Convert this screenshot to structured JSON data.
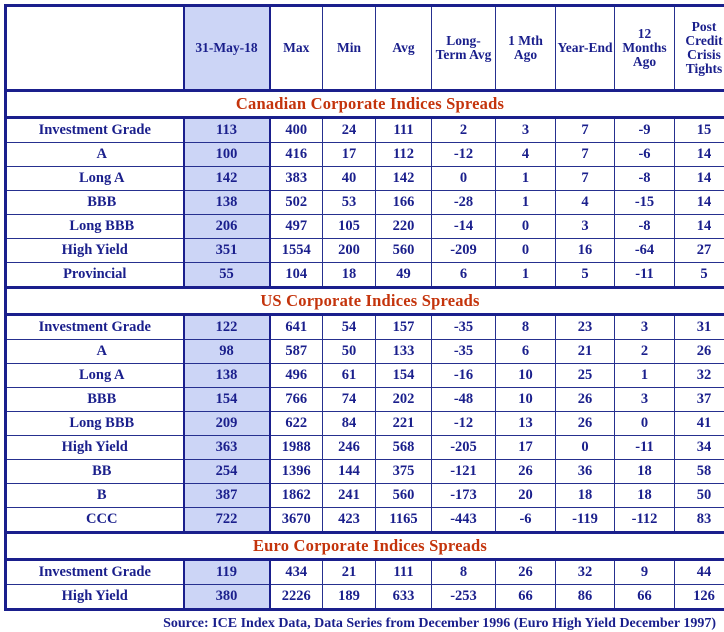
{
  "table": {
    "columns": [
      {
        "key": "label",
        "label": ""
      },
      {
        "key": "current",
        "label": "31-May-18",
        "highlighted": true
      },
      {
        "key": "max",
        "label": "Max"
      },
      {
        "key": "min",
        "label": "Min"
      },
      {
        "key": "avg",
        "label": "Avg"
      },
      {
        "key": "lta",
        "label": "Long-Term Avg"
      },
      {
        "key": "m1",
        "label": "1 Mth Ago"
      },
      {
        "key": "ye",
        "label": "Year-End"
      },
      {
        "key": "m12",
        "label": "12 Months Ago"
      },
      {
        "key": "pcct",
        "label": "Post Credit Crisis Tights"
      }
    ],
    "sections": [
      {
        "title": "Canadian Corporate Indices Spreads",
        "rows": [
          {
            "label": "Investment Grade",
            "indent": false,
            "values": [
              113,
              400,
              24,
              111,
              2,
              3,
              7,
              -9,
              15
            ]
          },
          {
            "label": "A",
            "indent": true,
            "values": [
              100,
              416,
              17,
              112,
              -12,
              4,
              7,
              -6,
              14
            ]
          },
          {
            "label": "Long A",
            "indent": true,
            "values": [
              142,
              383,
              40,
              142,
              0,
              1,
              7,
              -8,
              14
            ]
          },
          {
            "label": "BBB",
            "indent": true,
            "values": [
              138,
              502,
              53,
              166,
              -28,
              1,
              4,
              -15,
              14
            ]
          },
          {
            "label": "Long BBB",
            "indent": true,
            "values": [
              206,
              497,
              105,
              220,
              -14,
              0,
              3,
              -8,
              14
            ]
          },
          {
            "label": "High Yield",
            "indent": false,
            "values": [
              351,
              1554,
              200,
              560,
              -209,
              0,
              16,
              -64,
              27
            ]
          },
          {
            "label": "Provincial",
            "indent": false,
            "values": [
              55,
              104,
              18,
              49,
              6,
              1,
              5,
              -11,
              5
            ]
          }
        ]
      },
      {
        "title": "US Corporate Indices Spreads",
        "rows": [
          {
            "label": "Investment Grade",
            "indent": false,
            "values": [
              122,
              641,
              54,
              157,
              -35,
              8,
              23,
              3,
              31
            ]
          },
          {
            "label": "A",
            "indent": true,
            "values": [
              98,
              587,
              50,
              133,
              -35,
              6,
              21,
              2,
              26
            ]
          },
          {
            "label": "Long A",
            "indent": true,
            "values": [
              138,
              496,
              61,
              154,
              -16,
              10,
              25,
              1,
              32
            ]
          },
          {
            "label": "BBB",
            "indent": true,
            "values": [
              154,
              766,
              74,
              202,
              -48,
              10,
              26,
              3,
              37
            ]
          },
          {
            "label": "Long BBB",
            "indent": true,
            "values": [
              209,
              622,
              84,
              221,
              -12,
              13,
              26,
              0,
              41
            ]
          },
          {
            "label": "High Yield",
            "indent": false,
            "values": [
              363,
              1988,
              246,
              568,
              -205,
              17,
              0,
              -11,
              34
            ]
          },
          {
            "label": "BB",
            "indent": true,
            "values": [
              254,
              1396,
              144,
              375,
              -121,
              26,
              36,
              18,
              58
            ]
          },
          {
            "label": "B",
            "indent": true,
            "values": [
              387,
              1862,
              241,
              560,
              -173,
              20,
              18,
              18,
              50
            ]
          },
          {
            "label": "CCC",
            "indent": true,
            "values": [
              722,
              3670,
              423,
              1165,
              -443,
              -6,
              -119,
              -112,
              83
            ]
          }
        ]
      },
      {
        "title": "Euro Corporate Indices Spreads",
        "rows": [
          {
            "label": "Investment Grade",
            "indent": false,
            "values": [
              119,
              434,
              21,
              111,
              8,
              26,
              32,
              9,
              44
            ]
          },
          {
            "label": "High Yield",
            "indent": false,
            "values": [
              380,
              2226,
              189,
              633,
              -253,
              66,
              86,
              66,
              126
            ]
          }
        ]
      }
    ]
  },
  "source": "Source: ICE Index Data, Data Series from December 1996 (Euro High Yield December 1997)",
  "colors": {
    "text_primary": "#1a1f8c",
    "negative": "#c4340c",
    "section_title": "#c4340c",
    "highlight_column": "#ccd5f6",
    "border": "#26308f"
  }
}
